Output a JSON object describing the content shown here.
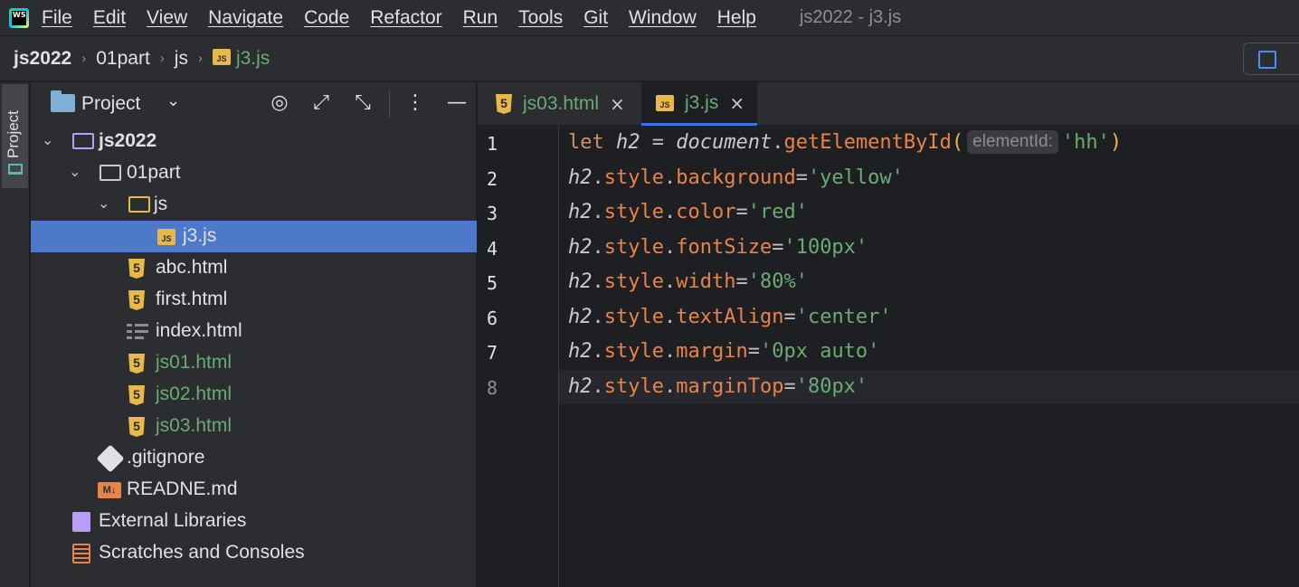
{
  "menu": {
    "items": [
      "File",
      "Edit",
      "View",
      "Navigate",
      "Code",
      "Refactor",
      "Run",
      "Tools",
      "Git",
      "Window",
      "Help"
    ],
    "window_title": "js2022 - j3.js"
  },
  "breadcrumb": {
    "project": "js2022",
    "folder": "01part",
    "subfolder": "js",
    "file": "j3.js"
  },
  "toolstrip": {
    "project_tab_label": "Project"
  },
  "project_panel": {
    "title": "Project",
    "tree": [
      {
        "label": "js2022",
        "type": "root"
      },
      {
        "label": "01part",
        "type": "folder"
      },
      {
        "label": "js",
        "type": "js-folder"
      },
      {
        "label": "j3.js",
        "type": "js-file"
      },
      {
        "label": "abc.html",
        "type": "html"
      },
      {
        "label": "first.html",
        "type": "html"
      },
      {
        "label": "index.html",
        "type": "index"
      },
      {
        "label": "js01.html",
        "type": "html-new"
      },
      {
        "label": "js02.html",
        "type": "html-new"
      },
      {
        "label": "js03.html",
        "type": "html-new"
      },
      {
        "label": ".gitignore",
        "type": "git"
      },
      {
        "label": "READNE.md",
        "type": "md"
      },
      {
        "label": "External Libraries",
        "type": "libs"
      },
      {
        "label": "Scratches and Consoles",
        "type": "scratches"
      }
    ]
  },
  "editor_tabs": [
    {
      "label": "js03.html",
      "active": false
    },
    {
      "label": "j3.js",
      "active": true
    }
  ],
  "editor": {
    "line_numbers": [
      "1",
      "2",
      "3",
      "4",
      "5",
      "6",
      "7",
      "8"
    ],
    "param_hint": "elementId:",
    "code": {
      "l1": {
        "kw": "let",
        "var": "h2",
        "eq": " = ",
        "obj": "document",
        "dot": ".",
        "fn": "getElementById",
        "open": "(",
        "arg": "'hh'",
        "close": ")"
      },
      "lines": [
        {
          "prop": "background",
          "val": "'yellow'"
        },
        {
          "prop": "color",
          "val": "'red'"
        },
        {
          "prop": "fontSize",
          "val": "'100px'"
        },
        {
          "prop": "width",
          "val": "'80%'"
        },
        {
          "prop": "textAlign",
          "val": "'center'"
        },
        {
          "prop": "margin",
          "val": "'0px auto'"
        },
        {
          "prop": "marginTop",
          "val": "'80px'"
        }
      ],
      "obj_var": "h2",
      "style_word": "style"
    }
  },
  "colors": {
    "selection": "#4c79c9",
    "new_file": "#6aab73",
    "accent": "#3574f0"
  }
}
